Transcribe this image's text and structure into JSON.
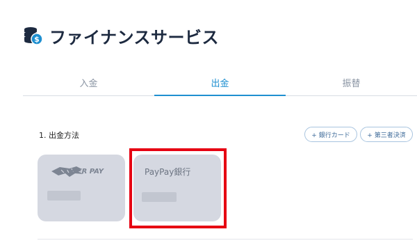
{
  "header": {
    "title": "ファイナンスサービス",
    "icon": "coin-stack-icon"
  },
  "tabs": [
    {
      "label": "入金",
      "active": false
    },
    {
      "label": "出金",
      "active": true
    },
    {
      "label": "振替",
      "active": false
    }
  ],
  "withdrawal": {
    "section_label": "1. 出金方法",
    "add_bank_card_label": "+ 銀行カード",
    "add_third_party_label": "+ 第三者決済",
    "methods": [
      {
        "name": "TIGER PAY",
        "logo": "tiger-pay-logo"
      },
      {
        "name": "PayPay銀行",
        "highlighted": true
      }
    ]
  },
  "colors": {
    "accent": "#1e8fd0",
    "highlight": "#e60012",
    "card_bg": "#d5d8e1"
  }
}
